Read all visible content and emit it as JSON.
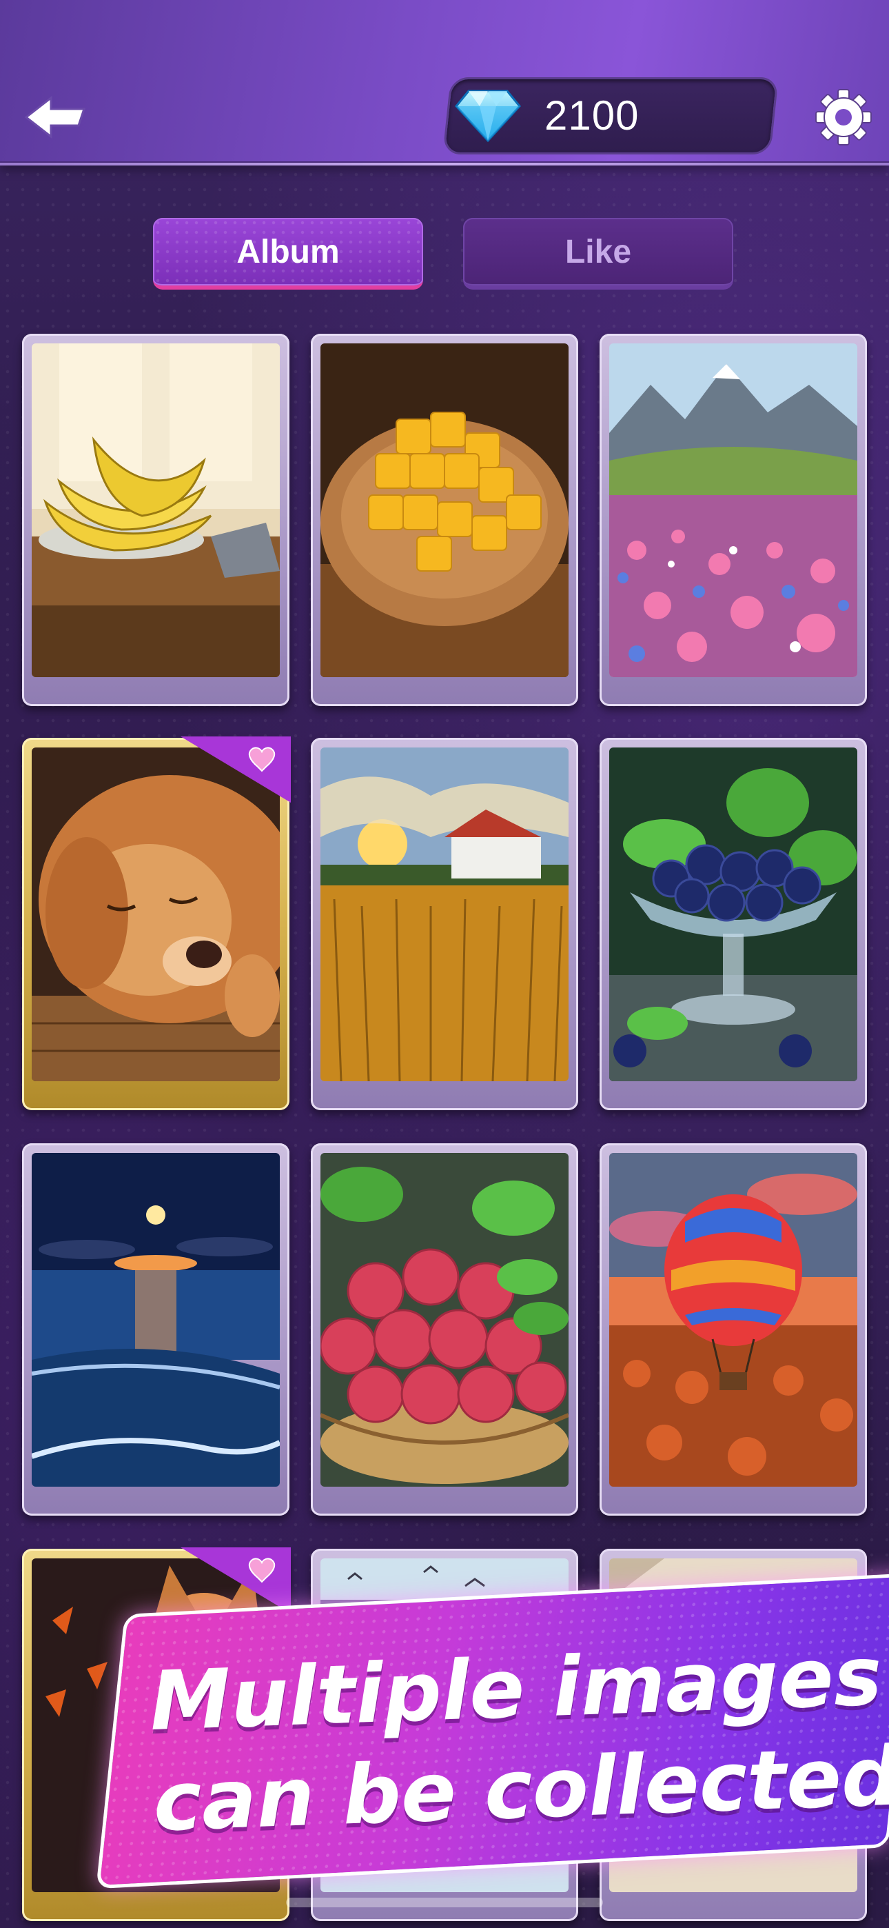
{
  "header": {
    "back_icon": "back-arrow-icon",
    "gem_icon": "diamond-gem-icon",
    "gem_count": "2100",
    "settings_icon": "gear-icon"
  },
  "tabs": [
    {
      "label": "Album",
      "active": true
    },
    {
      "label": "Like",
      "active": false
    }
  ],
  "grid": {
    "cards": [
      {
        "subject": "bananas",
        "favorite": false
      },
      {
        "subject": "mango cubes",
        "favorite": false
      },
      {
        "subject": "mountain flower meadow",
        "favorite": false
      },
      {
        "subject": "sleeping golden retriever",
        "favorite": true
      },
      {
        "subject": "wheat field farmhouse sunset",
        "favorite": false
      },
      {
        "subject": "blueberries in glass bowl",
        "favorite": false
      },
      {
        "subject": "moonlit beach",
        "favorite": false
      },
      {
        "subject": "lychees in basket",
        "favorite": false
      },
      {
        "subject": "hot air balloon",
        "favorite": false
      },
      {
        "subject": "corgi with autumn leaves",
        "favorite": true
      },
      {
        "subject": "seagulls over sea",
        "favorite": false
      },
      {
        "subject": "room light",
        "favorite": false
      }
    ],
    "favorite_icon": "heart-icon"
  },
  "promo": {
    "line1": "Multiple images",
    "line2": "can be collected"
  },
  "colors": {
    "accent_pink": "#e23ea0",
    "accent_purple": "#8a35e8",
    "gold_frame": "#d6b24e"
  }
}
